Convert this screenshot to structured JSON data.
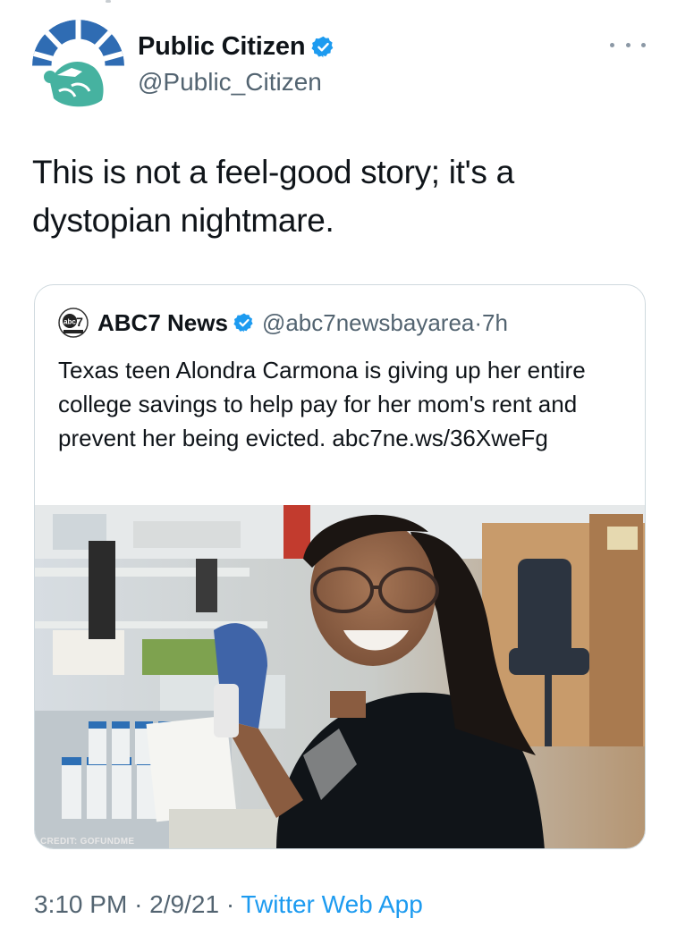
{
  "tweet": {
    "author": {
      "name": "Public Citizen",
      "handle": "@Public_Citizen",
      "avatar_icon": "statue-of-liberty-crown",
      "verified": true
    },
    "text": "This is not a feel-good story; it's a dystopian nightmare.",
    "more_icon": "ellipsis-horizontal",
    "time": "3:10 PM",
    "separator": "·",
    "date": "2/9/21",
    "source": "Twitter Web App"
  },
  "quote": {
    "author": {
      "name": "ABC7 News",
      "handle": "@abc7newsbayarea",
      "age": "7h",
      "logo_icon": "abc7-logo",
      "verified": true
    },
    "separator": "·",
    "text": "Texas teen Alondra Carmona is giving up her entire college savings to help pay for her mom's rent and prevent her being evicted. abc7ne.ws/36XweFg",
    "image_credit": "CREDIT: GOFUNDME"
  },
  "colors": {
    "text": "#0f1419",
    "muted": "#536471",
    "link": "#1d9bf0",
    "verified": "#1d9bf0",
    "border": "#cfd9de"
  }
}
